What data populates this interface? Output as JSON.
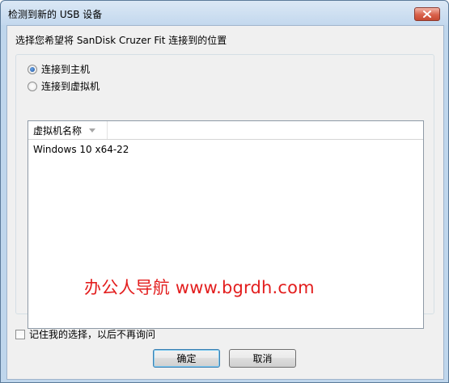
{
  "window": {
    "title": "检测到新的 USB 设备",
    "close_icon": "close-icon"
  },
  "prompt": "选择您希望将 SanDisk Cruzer Fit 连接到的位置",
  "options": [
    {
      "label": "连接到主机",
      "checked": true
    },
    {
      "label": "连接到虚拟机",
      "checked": false
    }
  ],
  "vm_list": {
    "column_header": "虚拟机名称",
    "rows": [
      "Windows 10 x64-22"
    ]
  },
  "watermark": "办公人导航 www.bgrdh.com",
  "remember_label": "记住我的选择，以后不再询问",
  "buttons": {
    "ok": "确定",
    "cancel": "取消"
  }
}
